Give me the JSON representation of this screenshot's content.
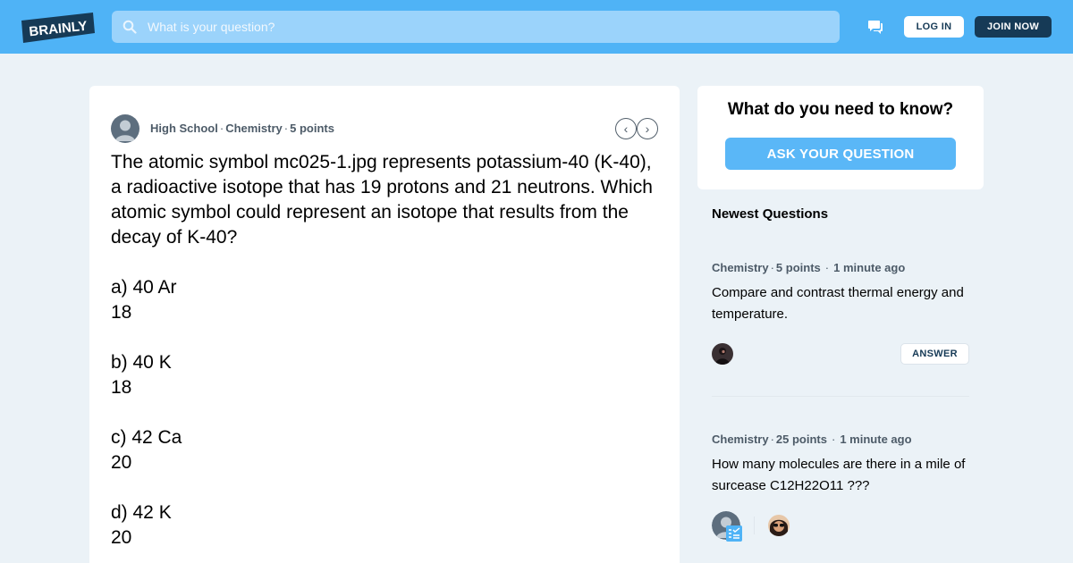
{
  "header": {
    "logo_text": "BRAINLY",
    "search_placeholder": "What is your question?",
    "login_label": "LOG IN",
    "join_label": "JOIN NOW",
    "brand_color": "#4fb3f6",
    "dark_color": "#163a56"
  },
  "question": {
    "level": "High School",
    "subject": "Chemistry",
    "points": "5 points",
    "text": "The atomic symbol mc025-1.jpg represents potassium-40 (K-40), a radioactive isotope that has 19 protons and 21 neutrons. Which atomic symbol could represent an isotope that results from the decay of K-40?\n\na) 40 Ar\n18\n\nb) 40 K\n18\n\nc) 42 Ca\n20\n\nd) 42 K\n20",
    "prev_glyph": "‹",
    "next_glyph": "›"
  },
  "ask": {
    "title": "What do you need to know?",
    "button_label": "ASK YOUR QUESTION",
    "button_color": "#5ab7f7"
  },
  "newest": {
    "title": "Newest Questions",
    "items": [
      {
        "subject": "Chemistry",
        "points": "5 points",
        "time": "1 minute ago",
        "text": "Compare and contrast thermal energy and temperature.",
        "answer_label": "ANSWER"
      },
      {
        "subject": "Chemistry",
        "points": "25 points",
        "time": "1 minute ago",
        "text": "How many molecules are there in a mile of surcease C12H22O11 ???"
      }
    ]
  },
  "icons": [
    "brainly-logo",
    "search-icon",
    "messages-icon",
    "avatar",
    "chevron-left-icon",
    "chevron-right-icon",
    "verified-badge-icon"
  ]
}
